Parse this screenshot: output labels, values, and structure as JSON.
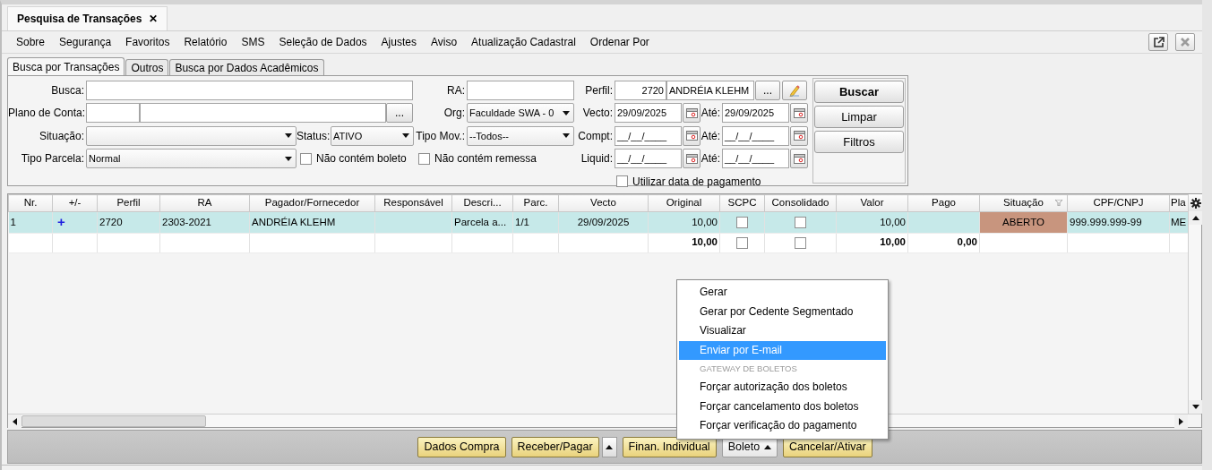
{
  "window_tabs": [
    {
      "label": "Pesquisa de Transações",
      "close": "✕",
      "selected": true
    }
  ],
  "menu": [
    "Sobre",
    "Segurança",
    "Favoritos",
    "Relatório",
    "SMS",
    "Seleção de Dados",
    "Ajustes",
    "Aviso",
    "Atualização Cadastral",
    "Ordenar Por"
  ],
  "toolbar_icons": [
    {
      "kind": "popout",
      "disabled": false
    },
    {
      "kind": "close",
      "disabled": true
    }
  ],
  "sub_tabs": [
    {
      "label": "Busca por Transações",
      "selected": true
    },
    {
      "label": "Outros",
      "selected": false
    },
    {
      "label": "Busca por Dados Acadêmicos",
      "selected": false
    }
  ],
  "form": {
    "busca": {
      "label": "Busca:"
    },
    "ra": {
      "label": "RA:"
    },
    "perfil": {
      "label": "Perfil:",
      "code": "2720",
      "name": "ANDRÉIA KLEHM",
      "lookup": "..."
    },
    "plano_conta": {
      "label": "Plano de Conta:",
      "lookup": "..."
    },
    "org": {
      "label": "Org:",
      "value": "Faculdade SWA - 0"
    },
    "vecto": {
      "label": "Vecto:",
      "from": "29/09/2025",
      "to_label": "Até:",
      "to": "29/09/2025"
    },
    "situacao": {
      "label": "Situação:"
    },
    "status": {
      "label": "Status:",
      "value": "ATIVO"
    },
    "tipo_mov": {
      "label": "Tipo Mov.:",
      "value": "--Todos--"
    },
    "compt": {
      "label": "Compt:",
      "from": "__/__/____",
      "to_label": "Até:",
      "to": "__/__/____"
    },
    "tipo_parcela": {
      "label": "Tipo Parcela:",
      "value": "Normal"
    },
    "nao_contem_boleto": {
      "label": "Não contém boleto",
      "checked": false
    },
    "nao_contem_remessa": {
      "label": "Não contém remessa",
      "checked": false
    },
    "liquid": {
      "label": "Liquid:",
      "from": "__/__/____",
      "to_label": "Até:",
      "to": "__/__/____"
    },
    "utilizar_data_pagamento": {
      "label": "Utilizar data de pagamento",
      "checked": false
    }
  },
  "actions": [
    {
      "label": "Buscar",
      "primary": true
    },
    {
      "label": "Limpar",
      "primary": false
    },
    {
      "label": "Filtros",
      "primary": false
    }
  ],
  "table": {
    "columns": [
      {
        "label": "Nr.",
        "kind": "text"
      },
      {
        "label": "+/-",
        "kind": "toggle"
      },
      {
        "label": "Perfil",
        "kind": "text"
      },
      {
        "label": "RA",
        "kind": "text"
      },
      {
        "label": "Pagador/Fornecedor",
        "kind": "text"
      },
      {
        "label": "Responsável",
        "kind": "text"
      },
      {
        "label": "Descri...",
        "kind": "text"
      },
      {
        "label": "Parc.",
        "kind": "text"
      },
      {
        "label": "Vecto",
        "kind": "date"
      },
      {
        "label": "Original",
        "kind": "number"
      },
      {
        "label": "SCPC",
        "kind": "check"
      },
      {
        "label": "Consolidado",
        "kind": "check"
      },
      {
        "label": "Valor",
        "kind": "number"
      },
      {
        "label": "Pago",
        "kind": "number"
      },
      {
        "label": "Situação",
        "kind": "status",
        "filter": true
      },
      {
        "label": "CPF/CNPJ",
        "kind": "text"
      },
      {
        "label": "Pla",
        "kind": "text"
      }
    ],
    "rows": [
      {
        "kind": "data",
        "selected": true,
        "color": "#c8957e",
        "cells": [
          "1",
          "+",
          "2720",
          "2303-2021",
          "ANDRÉIA KLEHM",
          null,
          "Parcela a...",
          "1/1",
          "29/09/2025",
          "10,00",
          false,
          false,
          "10,00",
          null,
          "ABERTO",
          "999.999.999-99",
          "ME"
        ]
      },
      {
        "kind": "total",
        "selected": false,
        "cells": [
          null,
          null,
          null,
          null,
          null,
          null,
          null,
          null,
          null,
          "10,00",
          false,
          false,
          "10,00",
          "0,00",
          null,
          null,
          null
        ]
      }
    ]
  },
  "bottom_buttons": [
    {
      "label": "Dados Compra",
      "kind": "action"
    },
    {
      "label": "Receber/Pagar",
      "kind": "action"
    },
    {
      "kind": "spin"
    },
    {
      "label": "Finan. Individual",
      "kind": "action"
    },
    {
      "label": "Boleto",
      "kind": "dropdown",
      "expanded": true
    },
    {
      "label": "Cancelar/Ativar",
      "kind": "action"
    }
  ],
  "popup": {
    "items": [
      {
        "label": "Gerar",
        "kind": "item",
        "selected": false
      },
      {
        "label": "Gerar por Cedente Segmentado",
        "kind": "item",
        "selected": false
      },
      {
        "label": "Visualizar",
        "kind": "item",
        "selected": false
      },
      {
        "label": "Enviar por E-mail",
        "kind": "item",
        "selected": true
      },
      {
        "label": "GATEWAY DE BOLETOS",
        "kind": "header",
        "selected": false
      },
      {
        "label": "Forçar autorização dos boletos",
        "kind": "item",
        "selected": false
      },
      {
        "label": "Forçar cancelamento dos boletos",
        "kind": "item",
        "selected": false
      },
      {
        "label": "Forçar verificação do pagamento",
        "kind": "item",
        "selected": false
      }
    ]
  }
}
